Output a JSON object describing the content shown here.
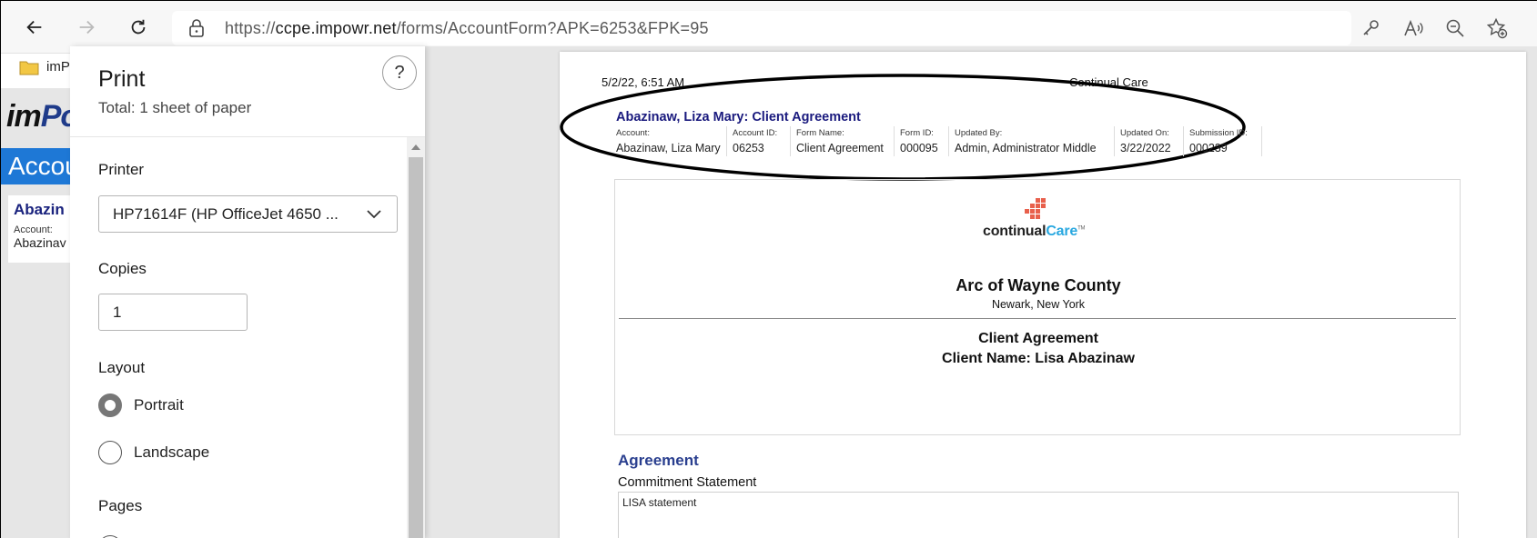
{
  "browser": {
    "url_prefix": "https://",
    "url_host": "ccpe.impowr.net",
    "url_path": "/forms/AccountForm?APK=6253&FPK=95"
  },
  "bookmarks": {
    "folder_label": "imP"
  },
  "background_page": {
    "logo_left": "im",
    "logo_right": "Po",
    "banner": "Accou",
    "card_title": "Abazin",
    "card_label": "Account:",
    "card_value": "Abazinav"
  },
  "print_panel": {
    "title": "Print",
    "subtitle": "Total: 1 sheet of paper",
    "help": "?",
    "printer_label": "Printer",
    "printer_value": "HP71614F (HP OfficeJet 4650 ...",
    "copies_label": "Copies",
    "copies_value": "1",
    "layout_label": "Layout",
    "layout_options": [
      "Portrait",
      "Landscape"
    ],
    "layout_selected": "Portrait",
    "pages_label": "Pages"
  },
  "preview": {
    "date": "5/2/22, 6:51 AM",
    "site_title": "Continual Care",
    "form_title": "Abazinaw, Liza Mary: Client Agreement",
    "meta": [
      {
        "key": "Account:",
        "value": "Abazinaw, Liza Mary"
      },
      {
        "key": "Account ID:",
        "value": "06253"
      },
      {
        "key": "Form Name:",
        "value": "Client Agreement"
      },
      {
        "key": "Form ID:",
        "value": "000095"
      },
      {
        "key": "Updated By:",
        "value": "Admin, Administrator Middle"
      },
      {
        "key": "Updated On:",
        "value": "3/22/2022"
      },
      {
        "key": "Submission ID:",
        "value": "000239"
      }
    ],
    "logo_word_dark": "continual",
    "logo_word_blue": "Care",
    "logo_tm": "TM",
    "org_name": "Arc of Wayne County",
    "org_location": "Newark, New York",
    "doc_title": "Client Agreement",
    "client_line": "Client Name: Lisa Abazinaw",
    "section_heading": "Agreement",
    "field_label": "Commitment Statement",
    "field_value": "LISA statement"
  },
  "colors": {
    "title_navy": "#1a1a7e",
    "section_blue": "#2a3f8f",
    "logo_blue": "#29a8e0",
    "logo_red": "#e8604c",
    "banner_blue": "#1e78d6"
  }
}
